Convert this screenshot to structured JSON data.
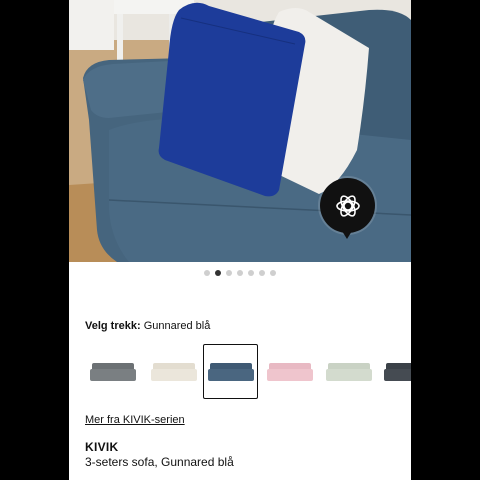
{
  "gallery": {
    "page_count": 7,
    "active_page": 2,
    "ar_button_icon": "augmented-reality-icon"
  },
  "cover": {
    "label": "Velg trekk:",
    "selected_value": "Gunnared blå",
    "options": [
      {
        "color": "#6c7174",
        "icon": "sofa-thumbnail-icon"
      },
      {
        "color": "#e3ddd0",
        "icon": "sofa-thumbnail-icon"
      },
      {
        "color": "#3f5a74",
        "icon": "sofa-thumbnail-icon",
        "selected": true
      },
      {
        "color": "#e8b9c3",
        "icon": "sofa-thumbnail-icon"
      },
      {
        "color": "#c9d2c4",
        "icon": "sofa-thumbnail-icon"
      },
      {
        "color": "#3b4148",
        "icon": "sofa-thumbnail-icon"
      }
    ]
  },
  "series_link": "Mer fra KIVIK-serien",
  "product": {
    "name": "KIVIK",
    "description": "3-seters sofa, Gunnared blå"
  },
  "colors": {
    "sofa": "#46657e",
    "cushion_blue": "#1d3c9a",
    "cushion_white": "#f1efeb",
    "floor": "#c9aa82",
    "rug": "#b88d58"
  }
}
